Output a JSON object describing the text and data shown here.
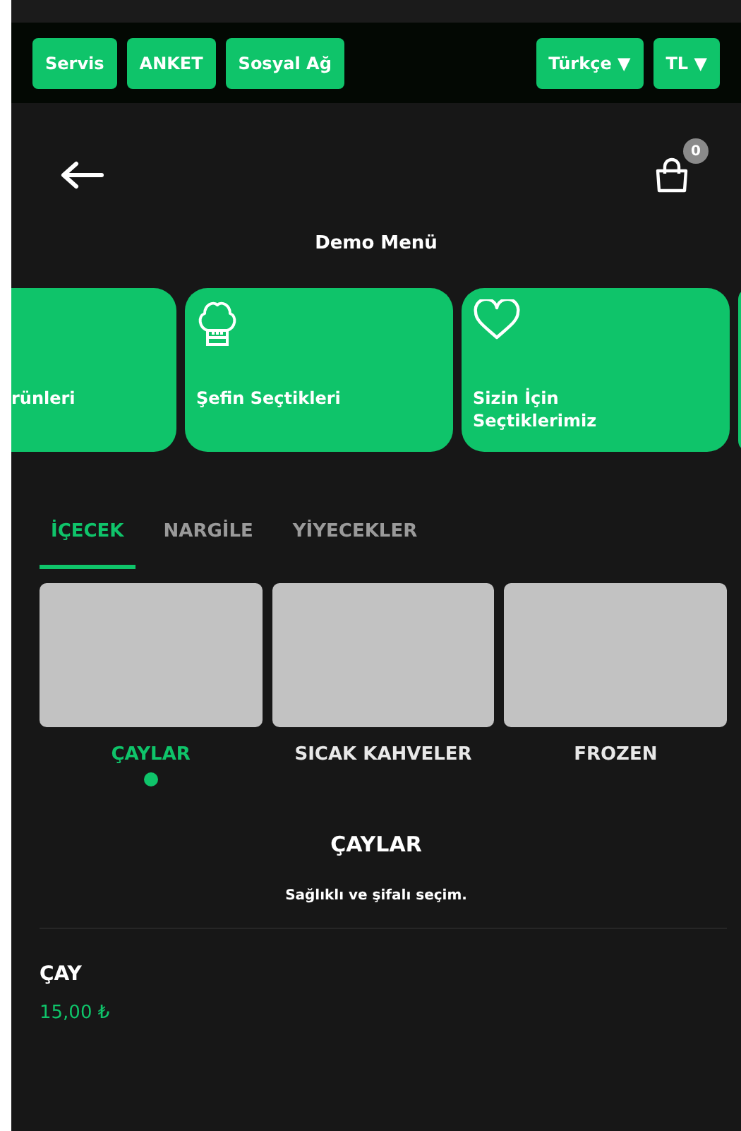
{
  "top_bar": {
    "left_buttons": [
      "Servis",
      "ANKET",
      "Sosyal Ağ"
    ],
    "right_dropdowns": [
      "Türkçe ▼",
      "TL ▼"
    ]
  },
  "header": {
    "cart_count": "0",
    "title": "Demo Menü"
  },
  "featured": [
    {
      "label": "rünleri",
      "kind": "plain"
    },
    {
      "label": "Şefin Seçtikleri",
      "kind": "chef"
    },
    {
      "label": "Sizin İçin Seçtiklerimiz",
      "kind": "favorite"
    },
    {
      "kind": "plain"
    }
  ],
  "tabs": [
    {
      "label": "İÇECEK",
      "selected": true
    },
    {
      "label": "NARGİLE",
      "selected": false
    },
    {
      "label": "YİYECEKLER",
      "selected": false
    }
  ],
  "subcategories": [
    {
      "label": "ÇAYLAR",
      "selected": true
    },
    {
      "label": "SICAK KAHVELER",
      "selected": false
    },
    {
      "label": "FROZEN",
      "selected": false
    }
  ],
  "section": {
    "title": "ÇAYLAR",
    "description": "Sağlıklı ve şifalı seçim."
  },
  "products": [
    {
      "name": "ÇAY",
      "price": "15,00 ₺"
    }
  ]
}
